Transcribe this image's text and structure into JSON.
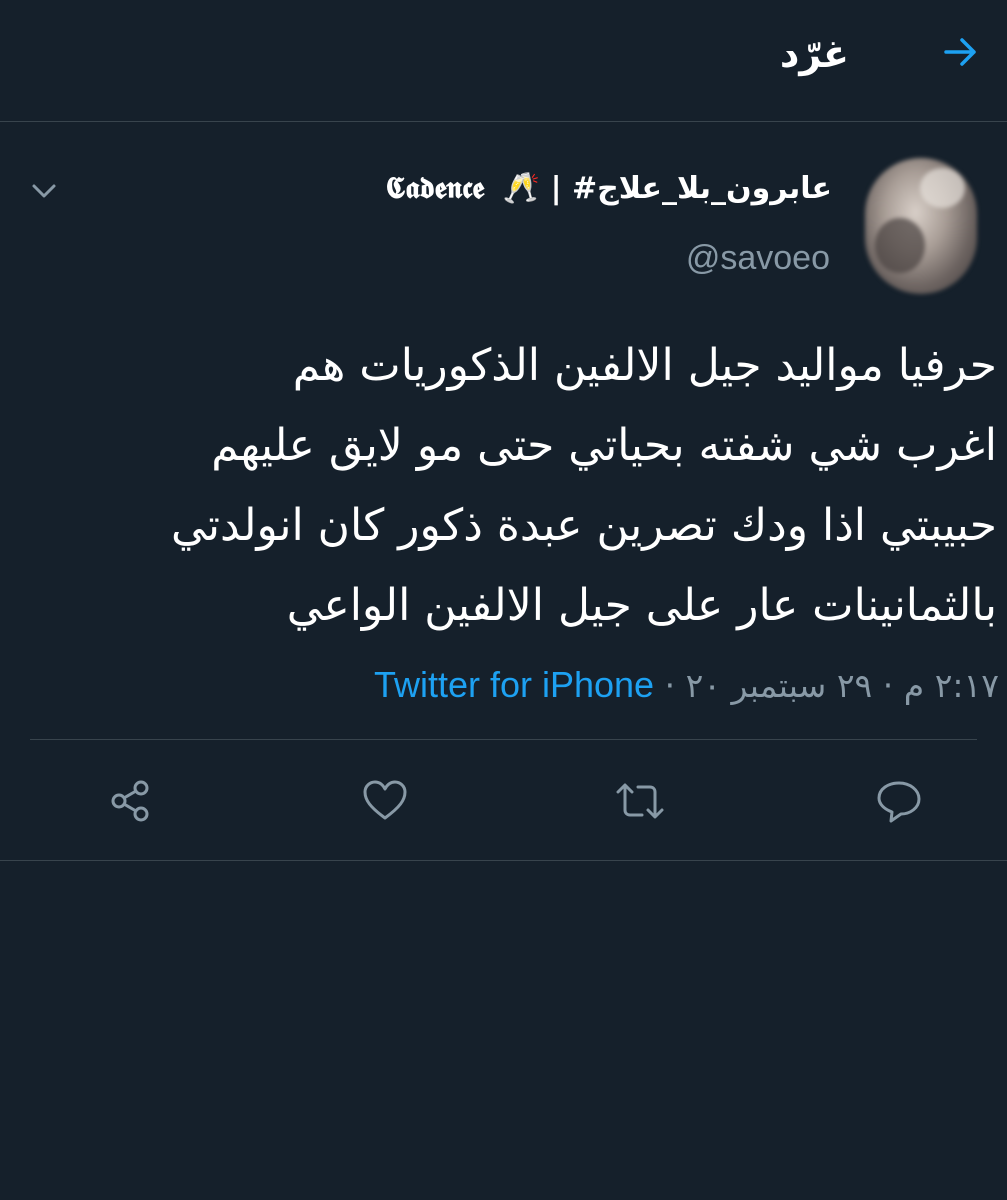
{
  "header": {
    "title": "غرّد",
    "back_icon": "arrow-right-icon",
    "accent": "#1da1f2"
  },
  "tweet": {
    "display_name": "عابرون_بلا_علاج# |",
    "display_name_brand": "𝕮𝖆𝖉𝖊𝖓𝖈𝖊",
    "display_name_emoji": "🥂",
    "handle": "@savoeo",
    "text_lines": [
      "حرفيا مواليد جيل الالفين الذكوريات هم",
      "اغرب شي شفته بحياتي حتى مو لايق عليهم",
      "حبيبتي اذا ودك تصرين عبدة ذكور كان انولدتي",
      "بالثمانينات عار على جيل الالفين الواعي"
    ],
    "time": "٢:١٧ م",
    "separator": "·",
    "date": "٢٩ سبتمبر ٢٠",
    "source": "Twitter for iPhone"
  },
  "actions": {
    "reply_icon": "reply-icon",
    "retweet_icon": "retweet-icon",
    "like_icon": "heart-icon",
    "share_icon": "share-icon"
  },
  "colors": {
    "background": "#15202b",
    "border": "#38444d",
    "secondary_text": "#8899a6",
    "link": "#1da1f2"
  }
}
